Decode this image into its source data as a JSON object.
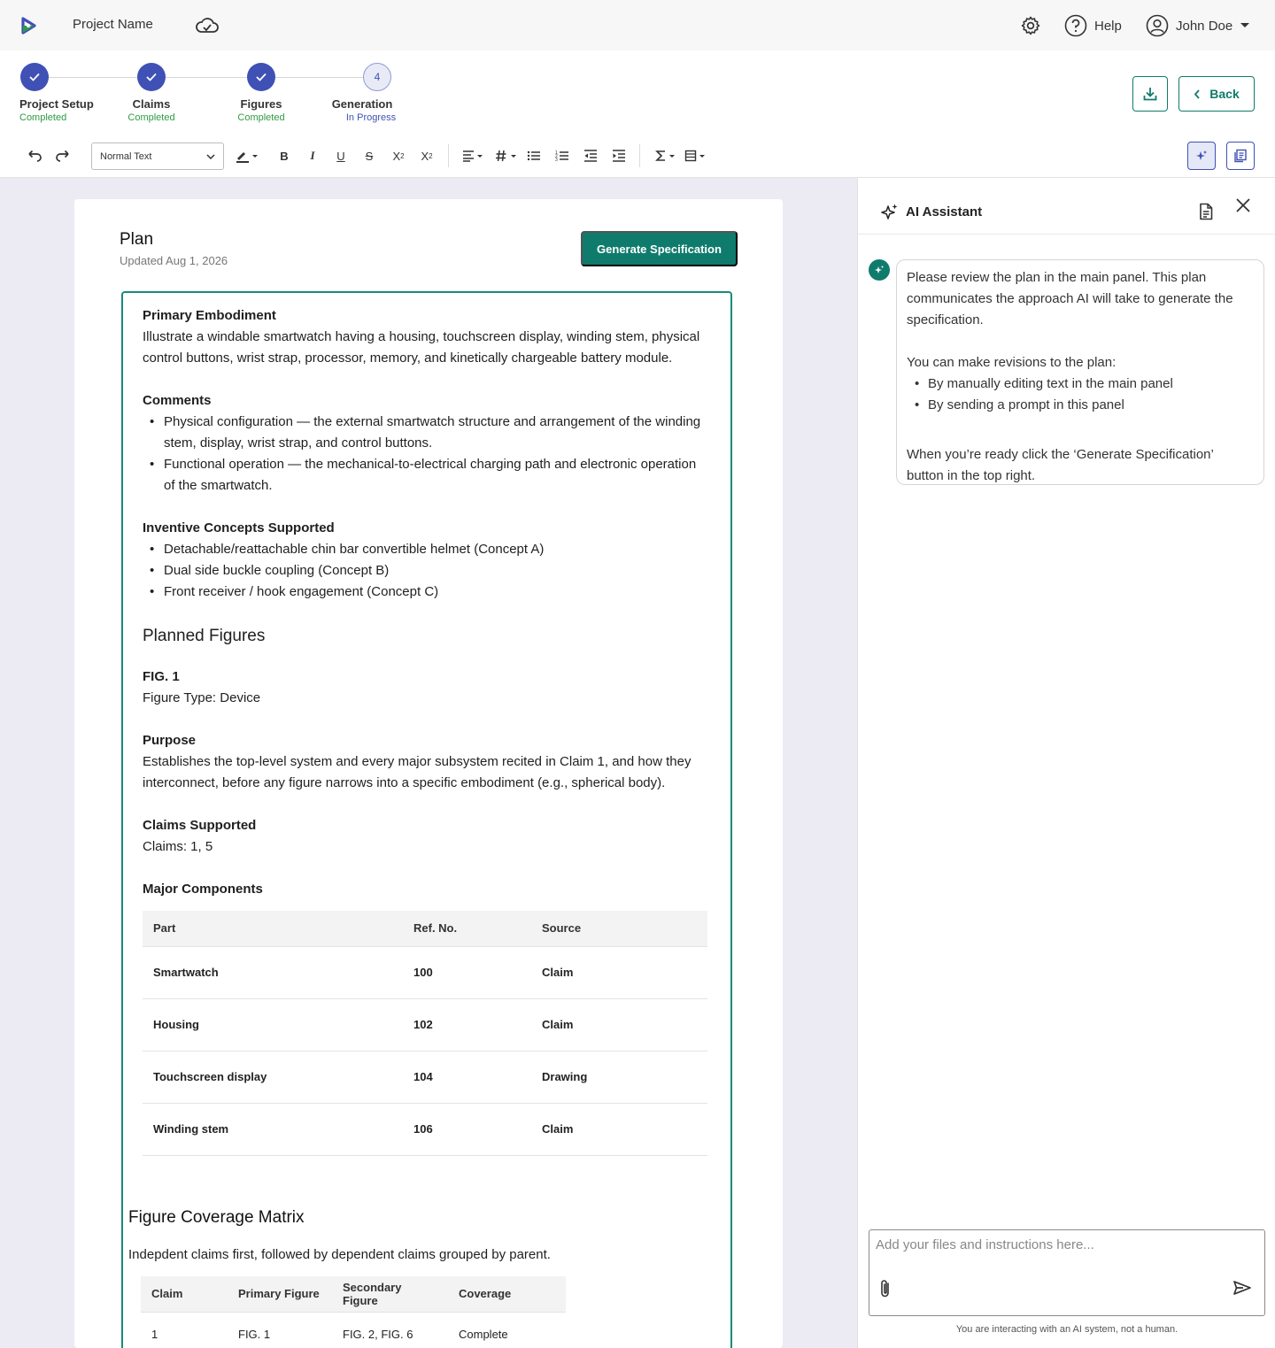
{
  "topbar": {
    "project_name": "Project Name",
    "help_label": "Help",
    "user_name": "John Doe"
  },
  "stepper": {
    "steps": [
      {
        "label": "Project Setup",
        "status": "Completed"
      },
      {
        "label": "Claims",
        "status": "Completed"
      },
      {
        "label": "Figures",
        "status": "Completed"
      },
      {
        "label": "Generation",
        "status": "In Progress",
        "number": "4"
      }
    ],
    "back_label": "Back"
  },
  "toolbar": {
    "text_style": "Normal Text"
  },
  "document": {
    "title": "Plan",
    "updated": "Updated Aug 1,  2026",
    "generate_label": "Generate Specification",
    "primary_heading": "Primary Embodiment",
    "primary_text": "Illustrate a windable smartwatch having a housing, touchscreen display, winding stem, physical control buttons, wrist strap, processor, memory, and kinetically chargeable battery module.",
    "comments_heading": "Comments",
    "comments": [
      "Physical configuration — the external smartwatch structure and arrangement of the winding stem, display, wrist strap, and control buttons.",
      "Functional operation — the mechanical-to-electrical charging path and electronic operation of the smartwatch."
    ],
    "concepts_heading": "Inventive Concepts Supported",
    "concepts": [
      "Detachable/reattachable chin bar convertible helmet (Concept A)",
      "Dual side buckle coupling (Concept B)",
      "Front receiver / hook engagement (Concept C)"
    ],
    "planned_heading": "Planned Figures",
    "fig_label": "FIG. 1",
    "fig_type": "Figure Type: Device",
    "purpose_heading": "Purpose",
    "purpose_text": "Establishes the top-level system and every major subsystem recited in Claim 1, and how they interconnect, before any figure narrows into a specific embodiment (e.g., spherical body).",
    "claims_heading": "Claims Supported",
    "claims_text": "Claims: 1, 5",
    "components_heading": "Major Components",
    "components_headers": [
      "Part",
      "Ref. No.",
      "Source"
    ],
    "components": [
      [
        "Smartwatch",
        "100",
        "Claim"
      ],
      [
        "Housing",
        "102",
        "Claim"
      ],
      [
        "Touchscreen display",
        "104",
        "Drawing"
      ],
      [
        "Winding stem",
        "106",
        "Claim"
      ]
    ],
    "matrix_title": "Figure Coverage Matrix",
    "matrix_desc": "Indepdent claims first, followed by dependent claims grouped by parent.",
    "matrix_headers": [
      "Claim",
      "Primary Figure",
      "Secondary Figure",
      "Coverage"
    ],
    "matrix_rows": [
      [
        "1",
        "FIG. 1",
        "FIG. 2, FIG. 6",
        "Complete"
      ]
    ]
  },
  "ai": {
    "title": "AI Assistant",
    "msg_intro": "Please review the plan in the main panel. This plan communicates the approach AI will take to generate the specification.",
    "msg_revisions": "You can make revisions to the plan:",
    "msg_bullets": [
      "By manually editing text in the main panel",
      "By sending a prompt in this panel"
    ],
    "msg_outro": "When you’re ready click the ‘Generate Specification’ button in the top right.",
    "input_placeholder": "Add your files and instructions here...",
    "disclaimer": "You are interacting with an AI system, not a human."
  },
  "colors": {
    "accent": "#0f7b6c",
    "step": "#3f51b5",
    "completed": "#2e9b44"
  }
}
